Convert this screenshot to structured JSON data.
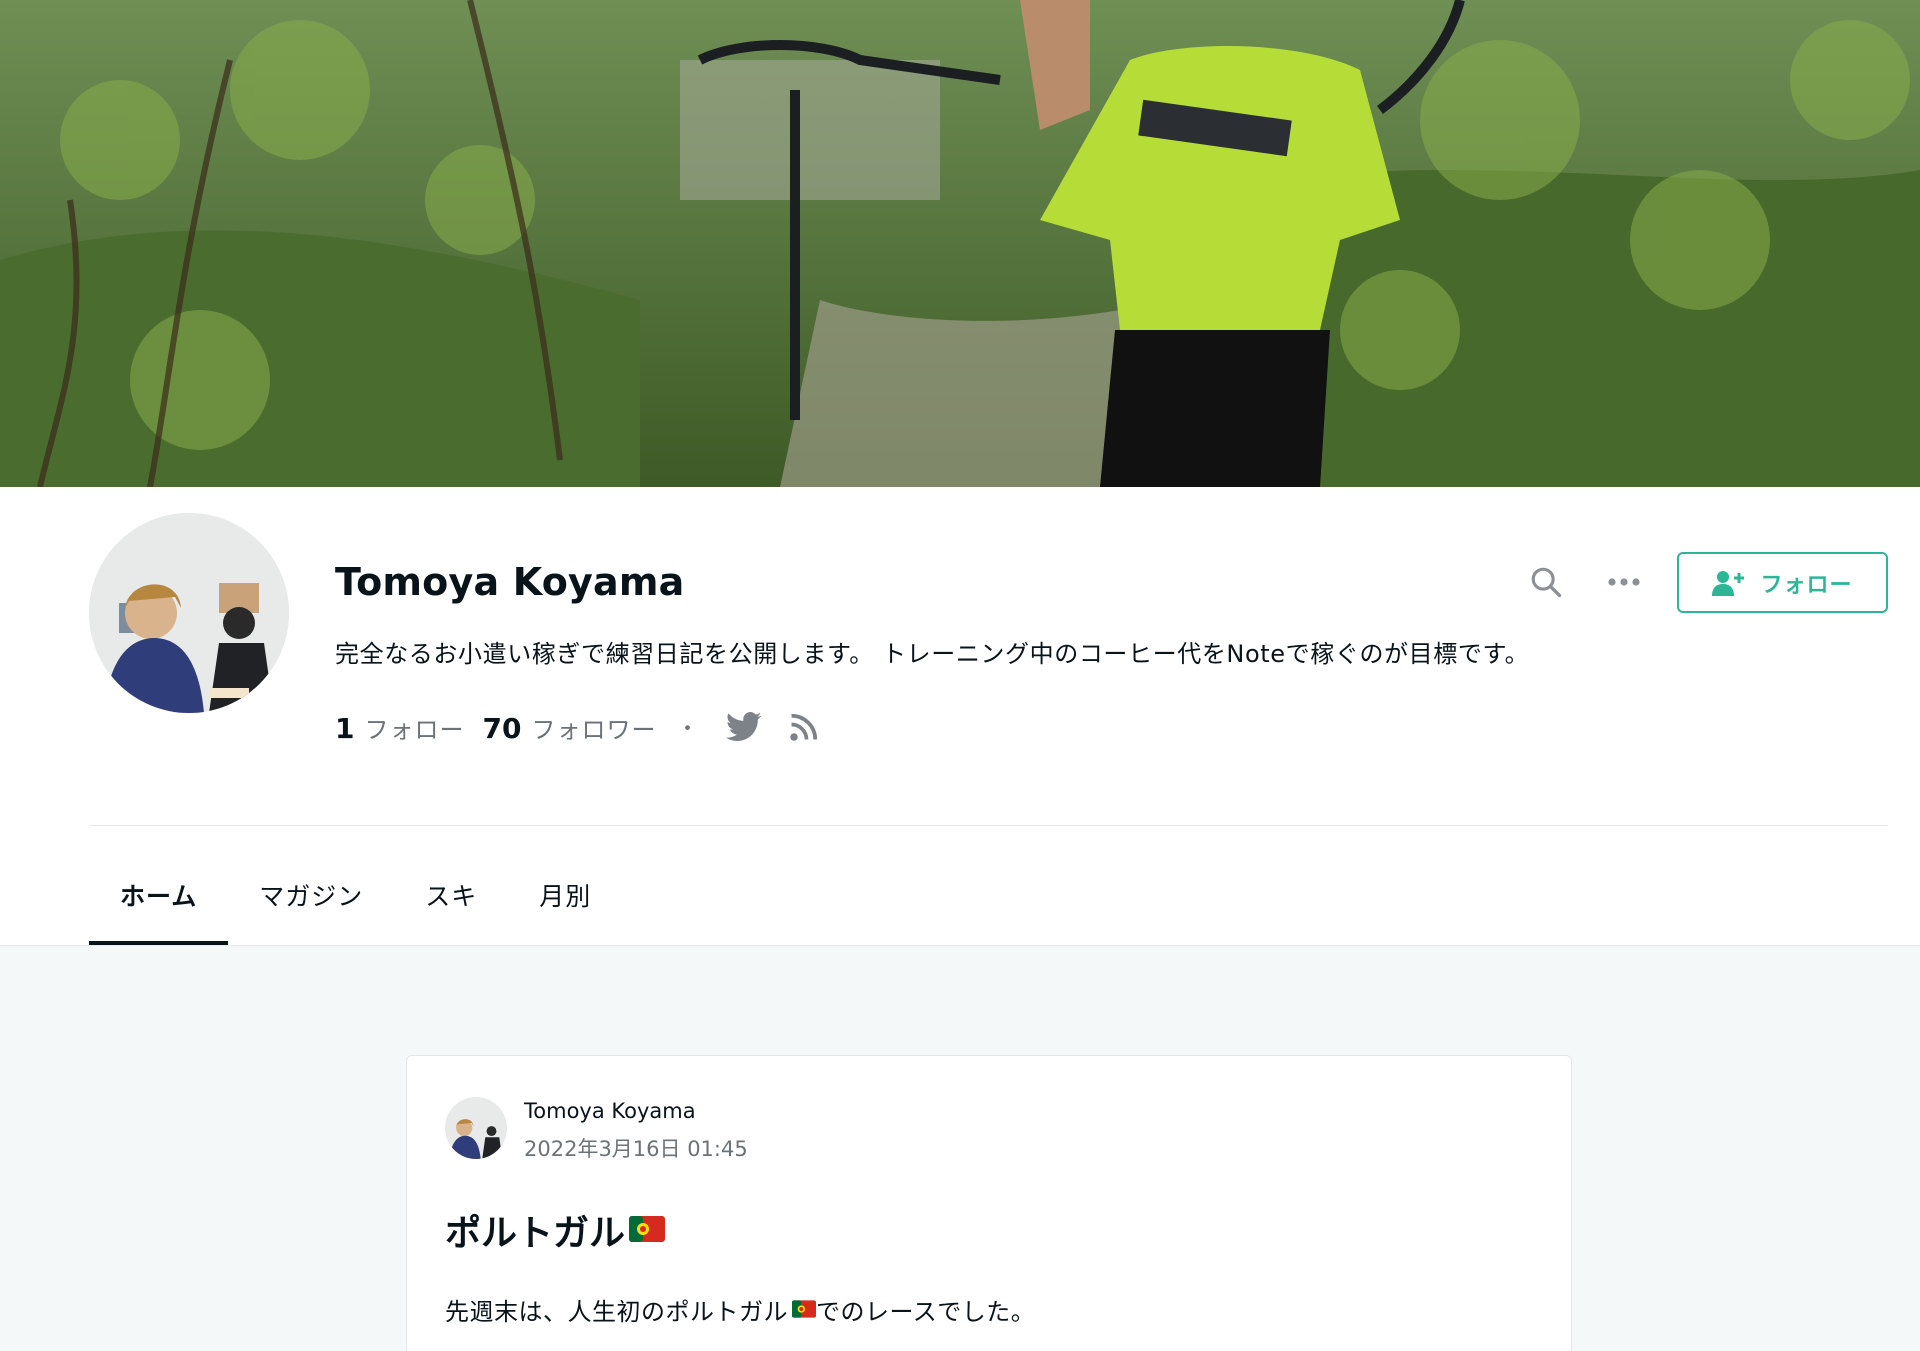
{
  "cover": {
    "image": "cover-photo-cyclist-carrying-bike-forest-trail"
  },
  "profile": {
    "name": "Tomoya Koyama",
    "bio": "完全なるお小遣い稼ぎで練習日記を公開します。 トレーニング中のコーヒー代をNoteで稼ぐのが目標です。",
    "following_count": "1",
    "following_label": "フォロー",
    "followers_count": "70",
    "followers_label": "フォロワー",
    "separator": "・",
    "follow_button_label": "フォロー",
    "icons": {
      "search": "search-icon",
      "more": "more-icon",
      "twitter": "twitter-icon",
      "rss": "rss-icon",
      "follow": "add-user-icon"
    }
  },
  "tabs": [
    {
      "label": "ホーム",
      "active": true
    },
    {
      "label": "マガジン",
      "active": false
    },
    {
      "label": "スキ",
      "active": false
    },
    {
      "label": "月別",
      "active": false
    }
  ],
  "post": {
    "author": "Tomoya Koyama",
    "date": "2022年3月16日 01:45",
    "title": "ポルトガル",
    "body_before": "先週末は、人生初のポルトガル",
    "body_after": "でのレースでした。"
  },
  "colors": {
    "accent": "#2cb696",
    "text": "#08131a",
    "muted": "#6b7378",
    "feed_bg": "#f5f8f8"
  }
}
